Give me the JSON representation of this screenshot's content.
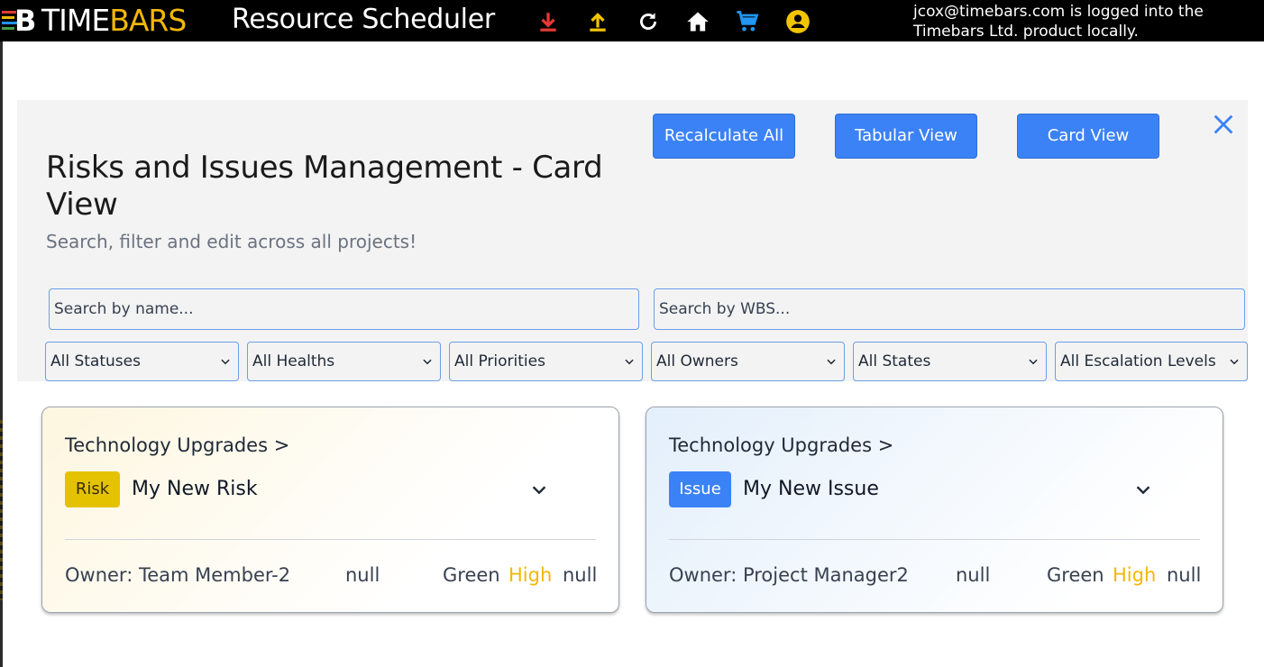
{
  "app": {
    "logo_part1": "TIME",
    "logo_part2": "BARS",
    "title": "Resource Scheduler",
    "login_message": "jcox@timebars.com is logged into the Timebars Ltd. product locally."
  },
  "toolbar_icons": [
    "download-icon",
    "upload-icon",
    "refresh-icon",
    "home-icon",
    "cart-icon",
    "account-icon"
  ],
  "header": {
    "recalculate_label": "Recalculate All",
    "tabular_label": "Tabular View",
    "card_label": "Card View",
    "title": "Risks and Issues Management - Card View",
    "subtitle": "Search, filter and edit across all projects!"
  },
  "search": {
    "name_placeholder": "Search by name...",
    "wbs_placeholder": "Search by WBS..."
  },
  "filters": {
    "status": "All Statuses",
    "health": "All Healths",
    "priority": "All Priorities",
    "owner": "All Owners",
    "state": "All States",
    "escalation": "All Escalation Levels"
  },
  "cards": [
    {
      "breadcrumb": "Technology Upgrades >",
      "type": "Risk",
      "name": "My New Risk",
      "owner": "Owner: Team Member-2",
      "field1": "null",
      "health": "Green",
      "priority": "High",
      "field2": "null"
    },
    {
      "breadcrumb": "Technology Upgrades >",
      "type": "Issue",
      "name": "My New Issue",
      "owner": "Owner: Project Manager2",
      "field1": "null",
      "health": "Green",
      "priority": "High",
      "field2": "null"
    }
  ],
  "colors": {
    "accent": "#3b82f6",
    "risk_badge": "#e4c200",
    "priority_high": "#f2b705",
    "download_icon": "#e53935",
    "upload_icon": "#f2c300",
    "cart_icon": "#2196f3",
    "account_icon": "#f2c300"
  }
}
